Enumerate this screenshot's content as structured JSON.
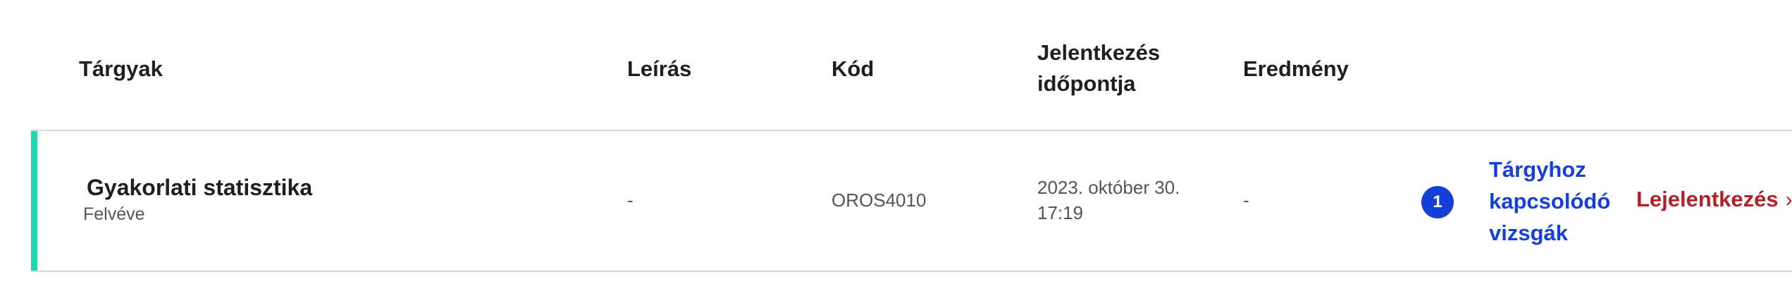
{
  "table": {
    "headers": {
      "subjects": "Tárgyak",
      "description": "Leírás",
      "code": "Kód",
      "applied_at": "Jelentkezés időpontja",
      "result": "Eredmény"
    },
    "rows": [
      {
        "title": "Gyakorlati statisztika",
        "status": "Felvéve",
        "description": "-",
        "code": "OROS4010",
        "applied_at": "2023. október 30. 17:19",
        "result": "-",
        "exam_count": "1",
        "exams_link": "Tárgyhoz kapcsolódó vizsgák",
        "unregister": "Lejelentkezés",
        "chevron": "›",
        "accent_color": "#1ed6b0"
      }
    ]
  },
  "icons": {
    "chevron": "chevron-right-icon"
  },
  "colors": {
    "link": "#1540d8",
    "danger": "#b3202a",
    "accent": "#1ed6b0"
  }
}
